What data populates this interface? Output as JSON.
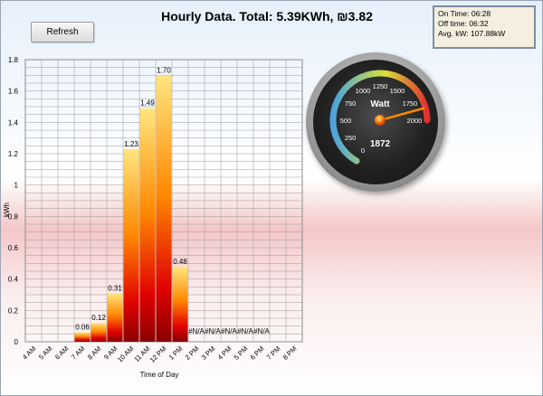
{
  "toolbar": {
    "refresh_label": "Refresh"
  },
  "header": {
    "title": "Hourly Data. Total: 5.39KWh, ₪3.82"
  },
  "info_box": {
    "on_time": "On Time: 06:28",
    "off_time": "Off time: 06:32",
    "avg_kw": "Avg. kW: 107.88kW"
  },
  "chart_data": {
    "type": "bar",
    "title": "Hourly Data. Total: 5.39KWh, ₪3.82",
    "xlabel": "Time of Day",
    "ylabel": "kWh",
    "ylim": [
      0,
      1.8
    ],
    "yticks": [
      "0",
      "0.2",
      "0.4",
      "0.6",
      "0.8",
      "1",
      "1.2",
      "1.4",
      "1.6",
      "1.8"
    ],
    "grid": true,
    "categories": [
      "4 AM",
      "5 AM",
      "6 AM",
      "7 AM",
      "8 AM",
      "9 AM",
      "10 AM",
      "11 AM",
      "12 PM",
      "1 PM",
      "2 PM",
      "3 PM",
      "4 PM",
      "5 PM",
      "6 PM",
      "7 PM",
      "8 PM"
    ],
    "values": [
      null,
      null,
      null,
      0.06,
      0.12,
      0.31,
      1.23,
      1.49,
      1.7,
      0.48,
      null,
      null,
      null,
      null,
      null,
      null,
      null
    ],
    "data_labels": [
      "",
      "",
      "",
      "0.06",
      "0.12",
      "0.31",
      "1.23",
      "1.49",
      "1.70",
      "0.48",
      "#N/A",
      "#N/A",
      "#N/A",
      "#N/A",
      "#N/A",
      "",
      ""
    ]
  },
  "gauge": {
    "unit": "Watt",
    "value": 1872,
    "value_label": "1872",
    "min": 0,
    "max": 2000,
    "ticks": [
      "0",
      "250",
      "500",
      "750",
      "1000",
      "1250",
      "1500",
      "1750",
      "2000"
    ]
  },
  "colors": {
    "bar_top": "#ffe680",
    "bar_mid": "#ff8800",
    "bar_bottom": "#8a0000",
    "gauge_low": "#4aa3df",
    "gauge_mid": "#d8e23a",
    "gauge_high": "#e03030"
  }
}
